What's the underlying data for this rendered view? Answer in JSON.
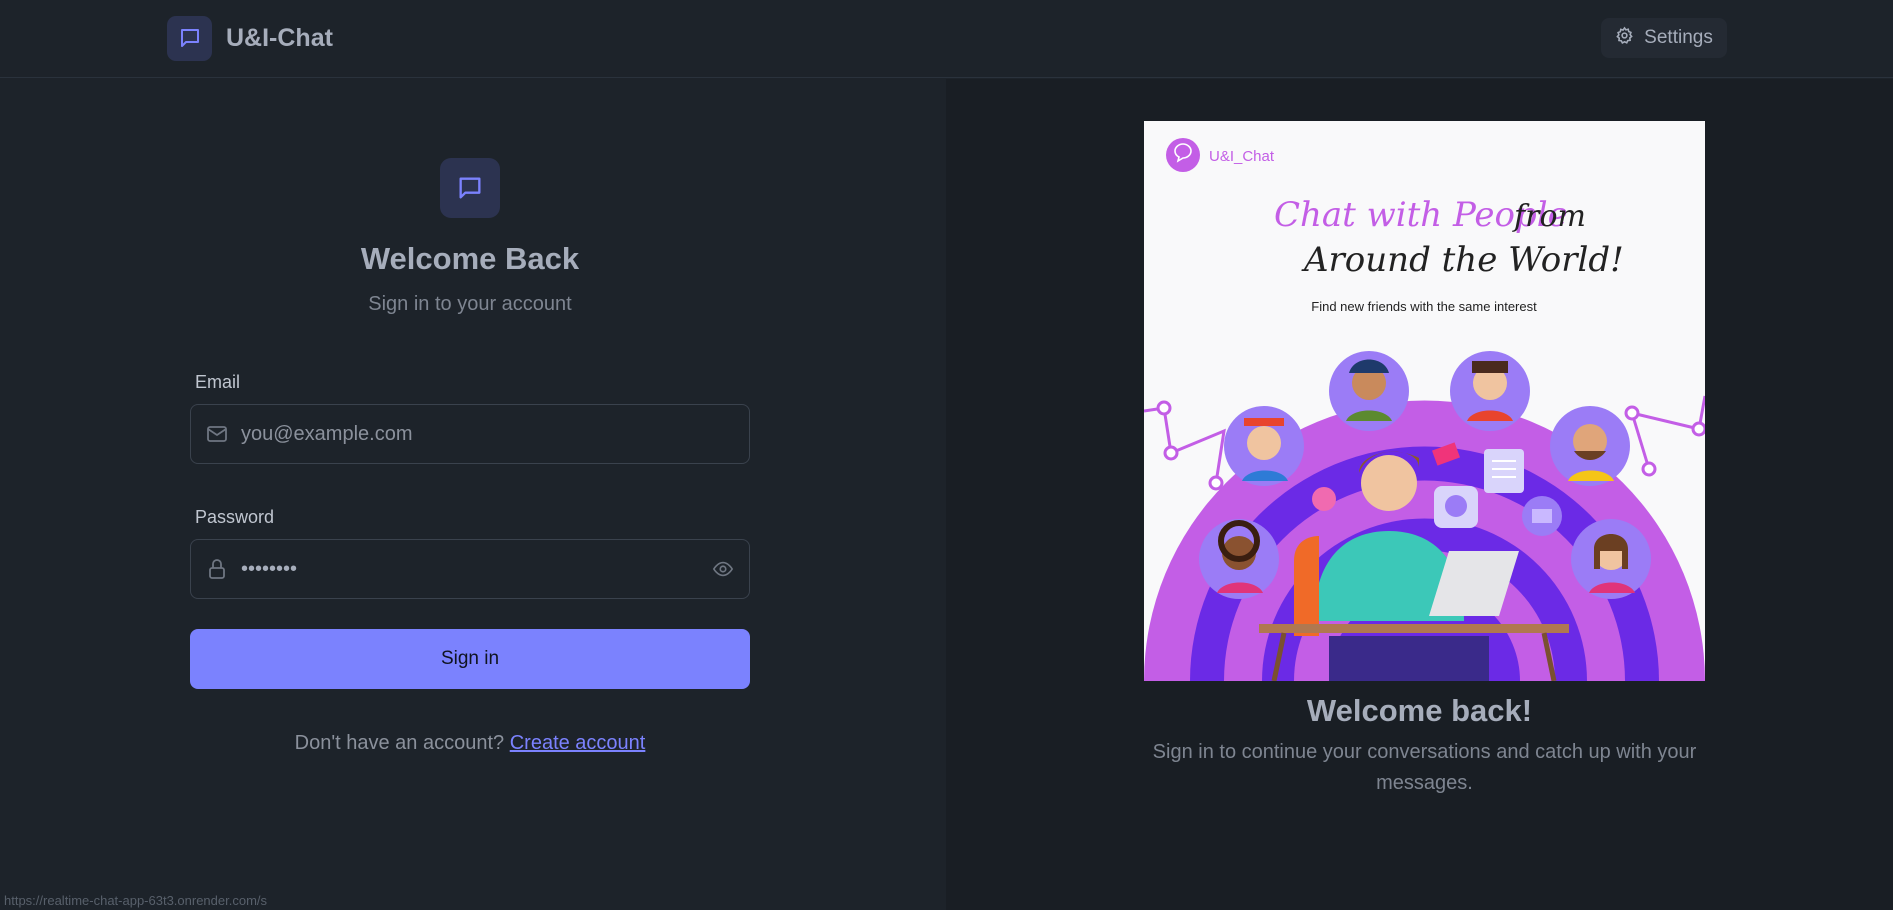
{
  "header": {
    "app_name": "U&I-Chat",
    "settings_label": "Settings"
  },
  "form": {
    "title": "Welcome Back",
    "subtitle": "Sign in to your account",
    "email_label": "Email",
    "email_placeholder": "you@example.com",
    "password_label": "Password",
    "password_value": "••••••••",
    "submit_label": "Sign in",
    "signup_prompt": "Don't have an account?",
    "signup_link": "Create account"
  },
  "promo": {
    "image": {
      "brand": "U&I_Chat",
      "headline_1": "Chat with People",
      "headline_2": "from",
      "headline_3": "Around the World!",
      "tagline": "Find new friends with the same interest"
    },
    "title": "Welcome back!",
    "subtitle": "Sign in to continue your conversations and catch up with your messages."
  },
  "status_bar": {
    "url": "https://realtime-chat-app-63t3.onrender.com/s"
  },
  "colors": {
    "background": "#1d232a",
    "panel": "#191e24",
    "primary": "#7b82fe",
    "illustration_purple": "#c35ee6",
    "illustration_violet": "#6b2ae6"
  },
  "icons": {
    "brand": "chat-bubble-icon",
    "settings": "gear-icon",
    "email": "mail-icon",
    "password": "lock-icon",
    "toggle": "eye-icon"
  }
}
